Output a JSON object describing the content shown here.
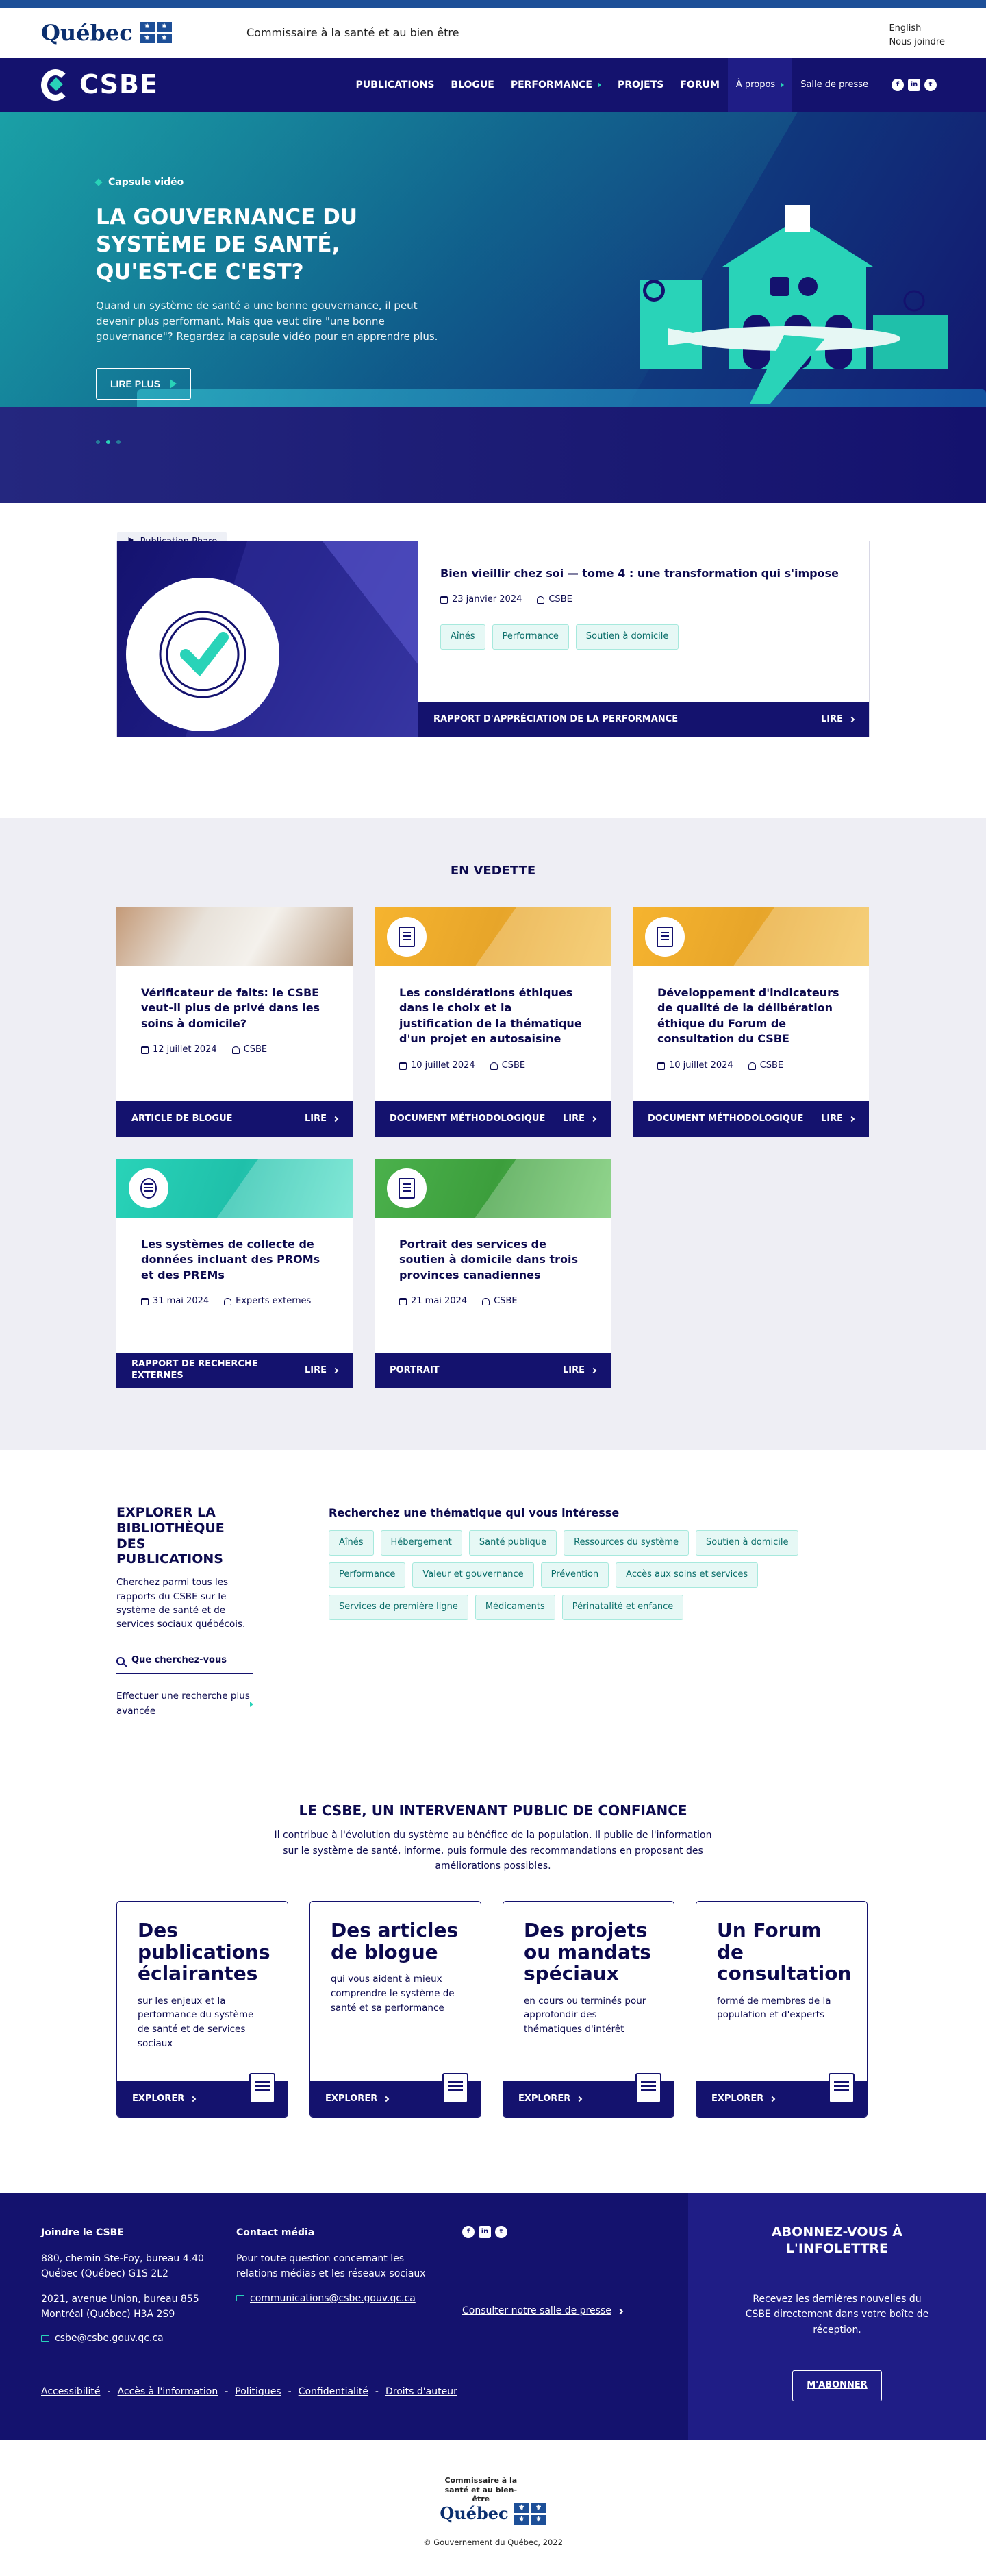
{
  "gov": {
    "logo": "Québec",
    "ministry": "Commissaire à la santé et au bien être",
    "links": [
      "English",
      "Nous joindre"
    ]
  },
  "nav": {
    "logo": "CSBE",
    "items": [
      "PUBLICATIONS",
      "BLOGUE",
      "PERFORMANCE",
      "PROJETS",
      "FORUM"
    ],
    "about": "À propos",
    "press": "Salle de presse",
    "socials": [
      "f",
      "in",
      "t"
    ]
  },
  "hero": {
    "capsule": "Capsule vidéo",
    "title": "LA GOUVERNANCE DU SYSTÈME DE SANTÉ, QU'EST-CE C'EST?",
    "text": "Quand un système de santé a une bonne gouvernance, il peut devenir plus performant. Mais que veut dire \"une bonne gouvernance\"? Regardez la capsule vidéo pour en apprendre plus.",
    "button": "LIRE PLUS"
  },
  "flagship": {
    "tag": "Publication Phare",
    "title": "Bien vieillir chez soi — tome 4 : une transformation qui s'impose",
    "date": "23 janvier 2024",
    "author": "CSBE",
    "tags": [
      "Aînés",
      "Performance",
      "Soutien à domicile"
    ],
    "type": "RAPPORT D'APPRÉCIATION DE LA PERFORMANCE",
    "lire": "LIRE"
  },
  "vedette": {
    "title": "EN VEDETTE",
    "cards": [
      {
        "title": "Vérificateur de faits: le CSBE veut-il plus de privé dans les soins à domicile?",
        "date": "12 juillet 2024",
        "author": "CSBE",
        "type": "ARTICLE DE BLOGUE",
        "lire": "LIRE",
        "thumb": "photo"
      },
      {
        "title": "Les considérations éthiques dans le choix et la justification de la thématique d'un projet en autosaisine",
        "date": "10 juillet 2024",
        "author": "CSBE",
        "type": "DOCUMENT MÉTHODOLOGIQUE",
        "lire": "LIRE",
        "thumb": "orange"
      },
      {
        "title": "Développement d'indicateurs de qualité de la délibération éthique du Forum de consultation du CSBE",
        "date": "10 juillet 2024",
        "author": "CSBE",
        "type": "DOCUMENT MÉTHODOLOGIQUE",
        "lire": "LIRE",
        "thumb": "orange"
      },
      {
        "title": "Les systèmes de collecte de données incluant des PROMs et des PREMs",
        "date": "31 mai 2024",
        "author": "Experts externes",
        "type": "RAPPORT DE RECHERCHE EXTERNES",
        "lire": "LIRE",
        "thumb": "teal"
      },
      {
        "title": "Portrait des services de soutien à domicile dans trois provinces canadiennes",
        "date": "21 mai 2024",
        "author": "CSBE",
        "type": "PORTRAIT",
        "lire": "LIRE",
        "thumb": "green"
      }
    ]
  },
  "explorer": {
    "title": "EXPLORER LA BIBLIOTHÈQUE DES PUBLICATIONS",
    "text": "Cherchez parmi tous les rapports du CSBE sur le système de santé et de services sociaux québécois.",
    "search_placeholder": "Que cherchez-vous",
    "advanced": "Effectuer une recherche plus avancée",
    "themes_title": "Recherchez une thématique qui vous intéresse",
    "themes": [
      "Aînés",
      "Hébergement",
      "Santé publique",
      "Ressources du système",
      "Soutien à domicile",
      "Performance",
      "Valeur et gouvernance",
      "Prévention",
      "Accès aux soins et services",
      "Services de première ligne",
      "Médicaments",
      "Périnatalité et enfance"
    ]
  },
  "intervenant": {
    "title": "LE CSBE, UN INTERVENANT PUBLIC DE CONFIANCE",
    "lead": "Il contribue à l'évolution du système au bénéfice de la population. Il publie de l'information sur le système de santé, informe, puis formule des recommandations en proposant des améliorations possibles.",
    "cards": [
      {
        "title": "Des publications éclairantes",
        "text": "sur les enjeux et la performance du système de santé et de services sociaux",
        "cta": "EXPLORER"
      },
      {
        "title": "Des articles de blogue",
        "text": "qui vous aident à mieux comprendre le système de santé et sa performance",
        "cta": "EXPLORER"
      },
      {
        "title": "Des projets ou mandats spéciaux",
        "text": "en cours ou terminés pour approfondir des thématiques d'intérêt",
        "cta": "EXPLORER"
      },
      {
        "title": "Un Forum de consultation",
        "text": "formé de membres de la population et d'experts",
        "cta": "EXPLORER"
      }
    ]
  },
  "footer": {
    "join_title": "Joindre le CSBE",
    "addr1": "880, chemin Ste-Foy, bureau 4.40 Québec (Québec) G1S 2L2",
    "addr2": "2021, avenue Union, bureau 855 Montréal (Québec) H3A 2S9",
    "email": "csbe@csbe.gouv.qc.ca",
    "media_title": "Contact média",
    "media_text": "Pour toute question concernant les relations médias et les réseaux sociaux",
    "media_email": "communications@csbe.gouv.qc.ca",
    "press_link": "Consulter notre salle de presse",
    "bottom_links": [
      "Accessibilité",
      "Accès à l'information",
      "Politiques",
      "Confidentialité",
      "Droits d'auteur"
    ],
    "sub_title": "ABONNEZ-VOUS À L'INFOLETTRE",
    "sub_text": "Recevez les dernières nouvelles du CSBE directement dans votre boîte de réception.",
    "sub_button": "M'ABONNER"
  },
  "bottom": {
    "logo_line": "Commissaire à la santé et au bien-être",
    "logo_word": "Québec",
    "copyright": "© Gouvernement du Québec, 2022"
  }
}
